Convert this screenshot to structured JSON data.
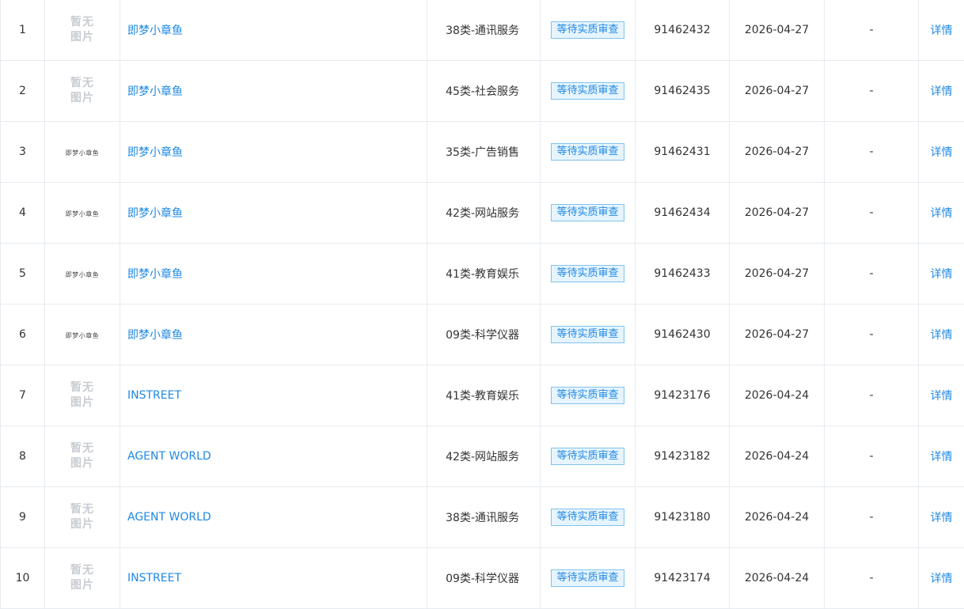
{
  "rows": [
    {
      "index": "1",
      "image": {
        "type": "none",
        "text1": "暂无",
        "text2": "图片"
      },
      "name": "即梦小章鱼",
      "class": "38类-通讯服务",
      "status": "等待实质审查",
      "reg_no": "91462432",
      "date": "2026-04-27",
      "extra": "-",
      "action": "详情"
    },
    {
      "index": "2",
      "image": {
        "type": "none",
        "text1": "暂无",
        "text2": "图片"
      },
      "name": "即梦小章鱼",
      "class": "45类-社会服务",
      "status": "等待实质审查",
      "reg_no": "91462435",
      "date": "2026-04-27",
      "extra": "-",
      "action": "详情"
    },
    {
      "index": "3",
      "image": {
        "type": "logo",
        "text": "即梦小章鱼"
      },
      "name": "即梦小章鱼",
      "class": "35类-广告销售",
      "status": "等待实质审查",
      "reg_no": "91462431",
      "date": "2026-04-27",
      "extra": "-",
      "action": "详情"
    },
    {
      "index": "4",
      "image": {
        "type": "logo",
        "text": "即梦小章鱼"
      },
      "name": "即梦小章鱼",
      "class": "42类-网站服务",
      "status": "等待实质审查",
      "reg_no": "91462434",
      "date": "2026-04-27",
      "extra": "-",
      "action": "详情"
    },
    {
      "index": "5",
      "image": {
        "type": "logo",
        "text": "即梦小章鱼"
      },
      "name": "即梦小章鱼",
      "class": "41类-教育娱乐",
      "status": "等待实质审查",
      "reg_no": "91462433",
      "date": "2026-04-27",
      "extra": "-",
      "action": "详情"
    },
    {
      "index": "6",
      "image": {
        "type": "logo",
        "text": "即梦小章鱼"
      },
      "name": "即梦小章鱼",
      "class": "09类-科学仪器",
      "status": "等待实质审查",
      "reg_no": "91462430",
      "date": "2026-04-27",
      "extra": "-",
      "action": "详情"
    },
    {
      "index": "7",
      "image": {
        "type": "none",
        "text1": "暂无",
        "text2": "图片"
      },
      "name": "INSTREET",
      "class": "41类-教育娱乐",
      "status": "等待实质审查",
      "reg_no": "91423176",
      "date": "2026-04-24",
      "extra": "-",
      "action": "详情"
    },
    {
      "index": "8",
      "image": {
        "type": "none",
        "text1": "暂无",
        "text2": "图片"
      },
      "name": "AGENT WORLD",
      "class": "42类-网站服务",
      "status": "等待实质审查",
      "reg_no": "91423182",
      "date": "2026-04-24",
      "extra": "-",
      "action": "详情"
    },
    {
      "index": "9",
      "image": {
        "type": "none",
        "text1": "暂无",
        "text2": "图片"
      },
      "name": "AGENT WORLD",
      "class": "38类-通讯服务",
      "status": "等待实质审查",
      "reg_no": "91423180",
      "date": "2026-04-24",
      "extra": "-",
      "action": "详情"
    },
    {
      "index": "10",
      "image": {
        "type": "none",
        "text1": "暂无",
        "text2": "图片"
      },
      "name": "INSTREET",
      "class": "09类-科学仪器",
      "status": "等待实质审查",
      "reg_no": "91423174",
      "date": "2026-04-24",
      "extra": "-",
      "action": "详情"
    }
  ]
}
